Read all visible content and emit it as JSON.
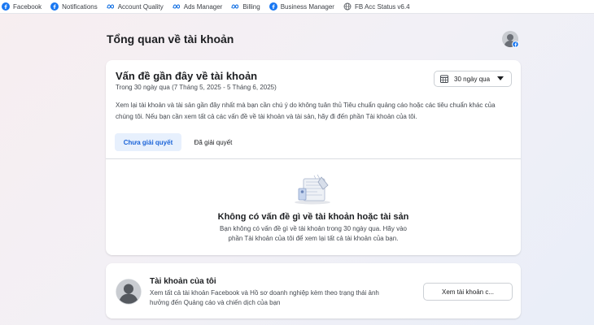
{
  "bookmarks": [
    {
      "label": "Facebook",
      "icon": "facebook-icon"
    },
    {
      "label": "Notifications",
      "icon": "facebook-icon"
    },
    {
      "label": "Account Quality",
      "icon": "meta-icon"
    },
    {
      "label": "Ads Manager",
      "icon": "meta-icon"
    },
    {
      "label": "Billing",
      "icon": "meta-icon"
    },
    {
      "label": "Business Manager",
      "icon": "facebook-icon"
    },
    {
      "label": "FB Acc Status v6.4",
      "icon": "globe-icon"
    }
  ],
  "page": {
    "title": "Tổng quan về tài khoản"
  },
  "issues": {
    "title": "Vấn đề gần đây về tài khoản",
    "subtitle": "Trong 30 ngày qua (7 Tháng 5, 2025 - 5 Tháng 6, 2025)",
    "date_range": "30 ngày qua",
    "description": "Xem lại tài khoản và tài sản gần đây nhất mà bạn cần chú ý do không tuân thủ Tiêu chuẩn quảng cáo hoặc các tiêu chuẩn khác của chúng tôi. Nếu bạn cần xem tất cả các vấn đề về tài khoản và tài sản, hãy đi đến phần Tài khoản của tôi.",
    "tabs": [
      {
        "label": "Chưa giải quyết",
        "active": true
      },
      {
        "label": "Đã giải quyết",
        "active": false
      }
    ],
    "empty_title": "Không có vấn đề gì về tài khoản hoặc tài sản",
    "empty_desc": "Bạn không có vấn đề gì về tài khoản trong 30 ngày qua. Hãy vào phần Tài khoản của tôi để xem lại tất cả tài khoản của bạn."
  },
  "my_accounts": {
    "title": "Tài khoản của tôi",
    "description": "Xem tất cả tài khoản Facebook và Hồ sơ doanh nghiệp kèm theo trạng thái ảnh hưởng đến Quảng cáo và chiến dịch của bạn",
    "button": "Xem tài khoản c..."
  },
  "colors": {
    "accent": "#1b64d8",
    "tab_active_bg": "#e7f0fd",
    "facebook_blue": "#1877f2"
  }
}
